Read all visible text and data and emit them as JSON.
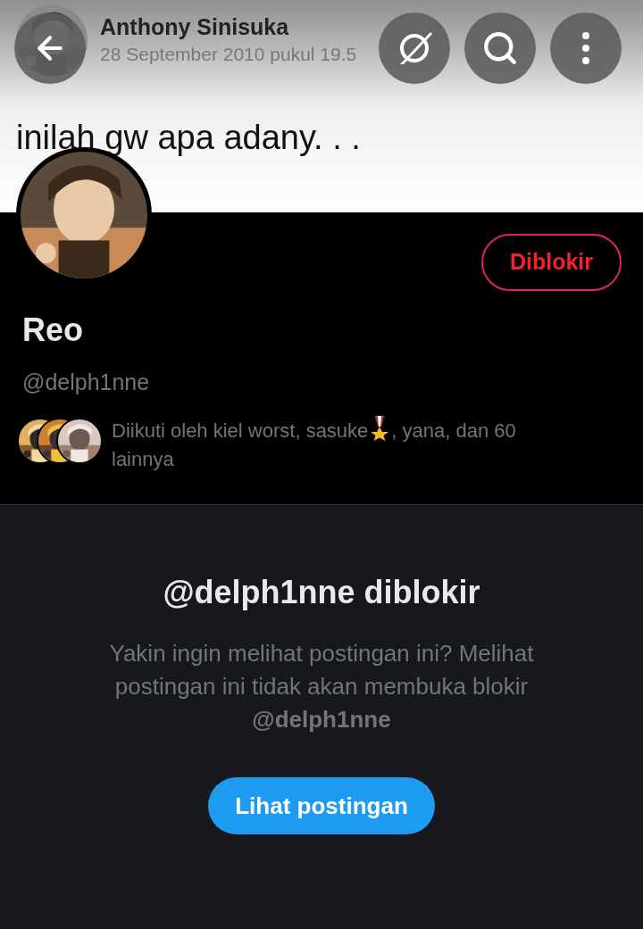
{
  "banner": {
    "author": "Anthony Sinisuka",
    "date": "28 September 2010 pukul 19.5",
    "post_text": "inilah gw apa adany. . ."
  },
  "profile": {
    "block_button": "Diblokir",
    "name": "Reo",
    "handle": "@delph1nne",
    "followed_by": [
      "Diikuti oleh kiel worst, sasuke",
      ", yana, dan 60 lainnya"
    ]
  },
  "blocked": {
    "title": "@delph1nne diblokir",
    "message": "Yakin ingin melihat postingan ini? Melihat postingan ini tidak akan membuka blokir **@delph1nne**",
    "button": "Lihat postingan"
  }
}
